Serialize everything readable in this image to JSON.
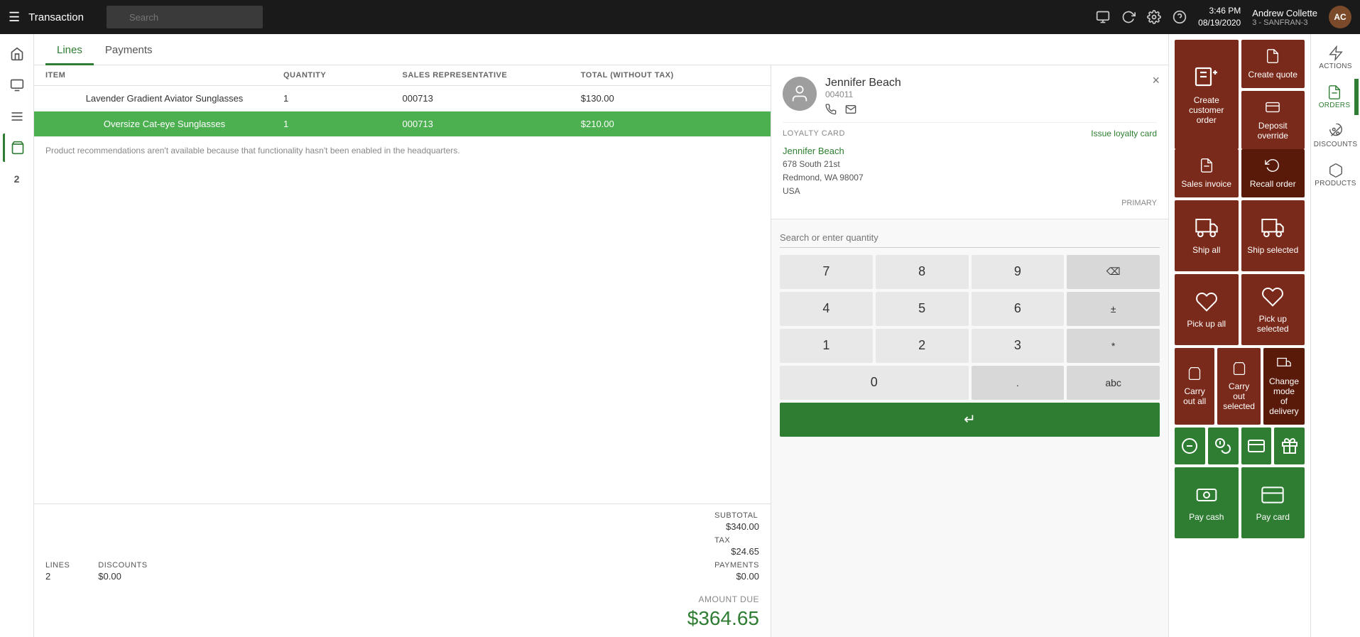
{
  "topbar": {
    "hamburger": "☰",
    "title": "Transaction",
    "search_placeholder": "Search",
    "time": "3:46 PM",
    "date": "08/19/2020",
    "user": "Andrew Collette",
    "store": "3 - SANFRAN-3",
    "avatar": "AC"
  },
  "tabs": [
    {
      "id": "lines",
      "label": "Lines",
      "active": true
    },
    {
      "id": "payments",
      "label": "Payments",
      "active": false
    }
  ],
  "table": {
    "headers": [
      "ITEM",
      "QUANTITY",
      "SALES REPRESENTATIVE",
      "TOTAL (WITHOUT TAX)"
    ],
    "rows": [
      {
        "name": "Lavender Gradient Aviator Sunglasses",
        "sub": "",
        "quantity": "1",
        "rep": "000713",
        "total": "$130.00",
        "selected": false
      },
      {
        "name": "Oversize Cat-eye Sunglasses",
        "sub": "",
        "quantity": "1",
        "rep": "000713",
        "total": "$210.00",
        "selected": true
      }
    ]
  },
  "recommendation_text": "Product recommendations aren't available because that functionality hasn't been enabled in the headquarters.",
  "summary": {
    "lines_label": "LINES",
    "lines_value": "2",
    "discounts_label": "DISCOUNTS",
    "discounts_value": "$0.00",
    "subtotal_label": "SUBTOTAL",
    "subtotal_value": "$340.00",
    "tax_label": "TAX",
    "tax_value": "$24.65",
    "payments_label": "PAYMENTS",
    "payments_value": "$0.00",
    "amount_due_label": "AMOUNT DUE",
    "amount_due_value": "$364.65"
  },
  "customer": {
    "name": "Jennifer Beach",
    "id": "004011",
    "loyalty_label": "LOYALTY CARD",
    "issue_loyalty": "Issue loyalty card",
    "name_link": "Jennifer Beach",
    "address_line1": "678 South 21st",
    "address_line2": "Redmond, WA 98007",
    "address_line3": "USA",
    "primary_label": "PRIMARY"
  },
  "numpad": {
    "search_placeholder": "Search or enter quantity",
    "buttons": [
      "7",
      "8",
      "9",
      "⌫",
      "4",
      "5",
      "6",
      "±",
      "1",
      "2",
      "3",
      "*",
      "0",
      ".",
      "abc"
    ],
    "enter_label": "↵"
  },
  "action_tiles": {
    "row1": [
      {
        "id": "create-customer-order",
        "label": "Create customer order",
        "icon": "customer-order-icon"
      },
      {
        "id": "create-quote",
        "label": "Create quote",
        "icon": "quote-icon"
      },
      {
        "id": "deposit-override",
        "label": "Deposit override",
        "icon": "deposit-icon"
      }
    ],
    "row2": [
      {
        "id": "sales-invoice",
        "label": "Sales invoice",
        "icon": "invoice-icon"
      },
      {
        "id": "recall-order",
        "label": "Recall order",
        "icon": "recall-icon"
      }
    ],
    "ship_row": [
      {
        "id": "ship-all",
        "label": "Ship all",
        "icon": "ship-all-icon"
      },
      {
        "id": "ship-selected",
        "label": "Ship selected",
        "icon": "ship-selected-icon"
      }
    ],
    "pickup_row": [
      {
        "id": "pick-up-all",
        "label": "Pick up all",
        "icon": "pickup-all-icon"
      },
      {
        "id": "pick-up-selected",
        "label": "Pick up selected",
        "icon": "pickup-selected-icon"
      }
    ],
    "carryout_row": [
      {
        "id": "carry-out-all",
        "label": "Carry out all",
        "icon": "carryout-all-icon"
      },
      {
        "id": "carry-out-selected",
        "label": "Carry out selected",
        "icon": "carryout-selected-icon"
      },
      {
        "id": "change-mode-delivery",
        "label": "Change mode of delivery",
        "icon": "delivery-icon"
      }
    ],
    "payment_icons": [
      {
        "id": "icon1",
        "icon": "minus-circle-icon"
      },
      {
        "id": "icon2",
        "icon": "coins-icon"
      },
      {
        "id": "icon3",
        "icon": "card-icon"
      },
      {
        "id": "icon4",
        "icon": "gift-icon"
      }
    ],
    "payment_row": [
      {
        "id": "pay-cash",
        "label": "Pay cash",
        "icon": "cash-icon"
      },
      {
        "id": "pay-card",
        "label": "Pay card",
        "icon": "paycard-icon"
      }
    ]
  },
  "right_icons": [
    {
      "id": "actions",
      "label": "ACTIONS",
      "icon": "actions-icon",
      "active": false
    },
    {
      "id": "orders",
      "label": "ORDERS",
      "icon": "orders-icon",
      "active": true
    },
    {
      "id": "discounts",
      "label": "DISCOUNTS",
      "icon": "discounts-icon",
      "active": false
    },
    {
      "id": "products",
      "label": "PRODUCTS",
      "icon": "products-icon",
      "active": false
    }
  ]
}
